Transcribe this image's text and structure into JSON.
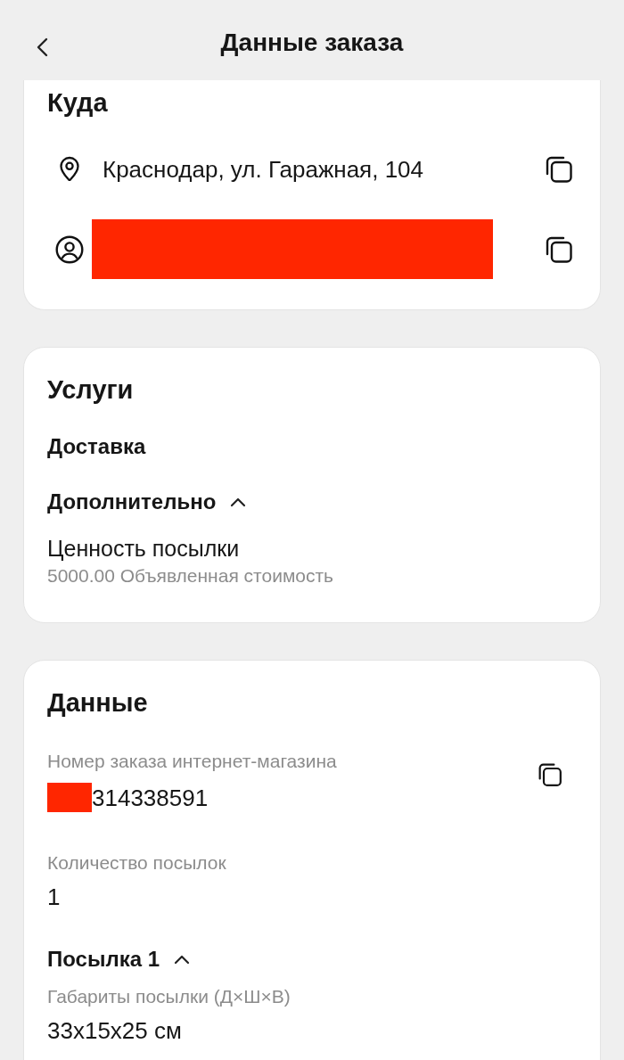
{
  "header": {
    "title": "Данные заказа"
  },
  "destination": {
    "title": "Куда",
    "rows": [
      {
        "kind": "address",
        "text": "Краснодар, ул. Гаражная, 104",
        "redacted": false,
        "copyable": true
      },
      {
        "kind": "recipient",
        "redacted": true,
        "copyable": true
      }
    ]
  },
  "services": {
    "title": "Услуги",
    "items": [
      {
        "kind": "heading",
        "label": "Доставка"
      },
      {
        "kind": "group",
        "label": "Дополнительно",
        "expanded": true,
        "children": [
          {
            "name": "Ценность посылки",
            "detail": "5000.00 Объявленная стоимость"
          }
        ]
      }
    ]
  },
  "details": {
    "title": "Данные",
    "fields": [
      {
        "label": "Номер заказа интернет-магазина",
        "value": "314338591",
        "redacted": true,
        "copyable": true
      },
      {
        "label": "Количество посылок",
        "value": "1",
        "redacted": false,
        "copyable": false
      }
    ],
    "parcels": [
      {
        "title": "Посылка 1",
        "expanded": true,
        "fields": [
          {
            "label": "Габариты посылки (Д×Ш×В)",
            "value": "33x15x25 см"
          }
        ]
      }
    ]
  }
}
